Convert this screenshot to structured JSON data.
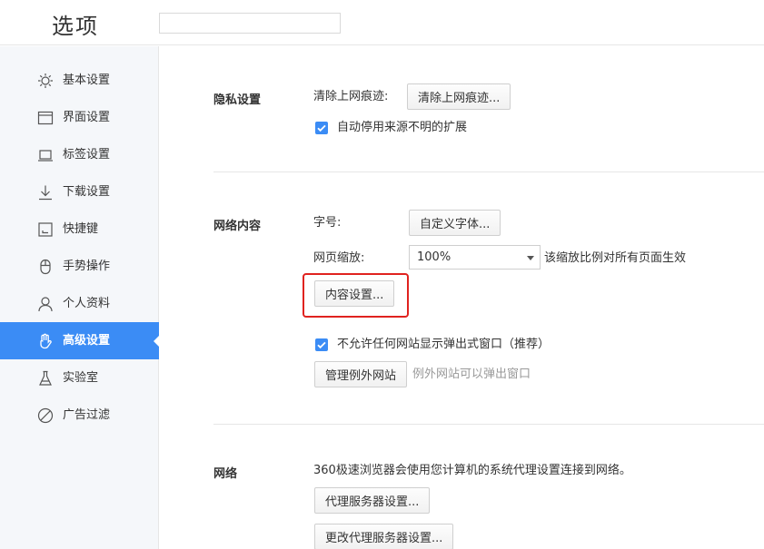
{
  "header": {
    "title": "选项",
    "search_placeholder": ""
  },
  "sidebar": {
    "items": [
      {
        "label": "基本设置",
        "icon": "sun-icon"
      },
      {
        "label": "界面设置",
        "icon": "window-icon"
      },
      {
        "label": "标签设置",
        "icon": "laptop-icon"
      },
      {
        "label": "下载设置",
        "icon": "download-icon"
      },
      {
        "label": "快捷键",
        "icon": "keyboard-shortcut-icon"
      },
      {
        "label": "手势操作",
        "icon": "mouse-icon"
      },
      {
        "label": "个人资料",
        "icon": "user-icon"
      },
      {
        "label": "高级设置",
        "icon": "gesture-hand-icon",
        "active": true
      },
      {
        "label": "实验室",
        "icon": "flask-icon"
      },
      {
        "label": "广告过滤",
        "icon": "block-icon"
      }
    ]
  },
  "privacy": {
    "title": "隐私设置",
    "clear_label": "清除上网痕迹:",
    "clear_button": "清除上网痕迹...",
    "auto_disable_ext": {
      "label": "自动停用来源不明的扩展",
      "checked": true
    }
  },
  "content": {
    "title": "网络内容",
    "font_label": "字号:",
    "font_button": "自定义字体...",
    "zoom_label": "网页缩放:",
    "zoom_value": "100%",
    "zoom_hint": "该缩放比例对所有页面生效",
    "content_settings_button": "内容设置...",
    "popup_block": {
      "label": "不允许任何网站显示弹出式窗口（推荐）",
      "checked": true
    },
    "manage_exceptions_button": "管理例外网站",
    "exceptions_hint": "例外网站可以弹出窗口"
  },
  "network": {
    "title": "网络",
    "description": "360极速浏览器会使用您计算机的系统代理设置连接到网络。",
    "proxy_button": "代理服务器设置...",
    "change_proxy_button": "更改代理服务器设置..."
  },
  "colors": {
    "accent": "#3b8cf5",
    "highlight": "#e0221f"
  }
}
